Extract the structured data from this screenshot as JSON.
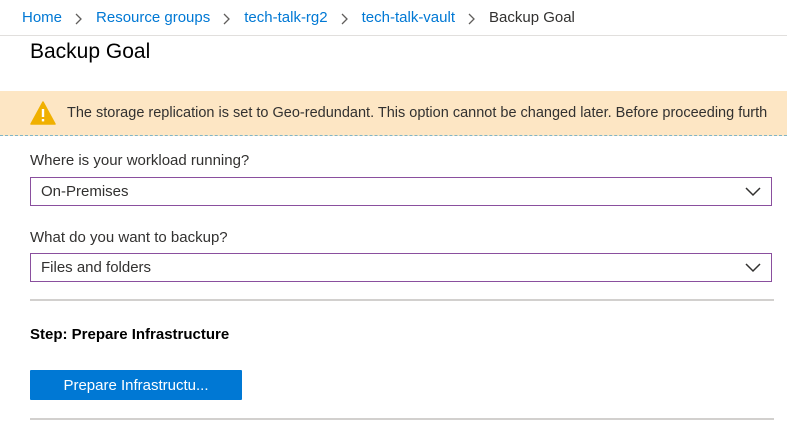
{
  "breadcrumb": {
    "items": [
      {
        "label": "Home"
      },
      {
        "label": "Resource groups"
      },
      {
        "label": "tech-talk-rg2"
      },
      {
        "label": "tech-talk-vault"
      }
    ],
    "current": "Backup Goal"
  },
  "page": {
    "title": "Backup Goal"
  },
  "warning": {
    "icon": "warning-icon",
    "text": "The storage replication is set to Geo-redundant. This option cannot be changed later. Before proceeding furth"
  },
  "form": {
    "workload": {
      "label": "Where is your workload running?",
      "value": "On-Premises"
    },
    "backup": {
      "label": "What do you want to backup?",
      "value": "Files and folders"
    }
  },
  "step": {
    "title": "Step: Prepare Infrastructure",
    "button_label": "Prepare Infrastructu..."
  },
  "colors": {
    "accent": "#0078d4",
    "warning_bg": "#fde6c4",
    "warning_icon": "#f0b000",
    "select_border": "#8a4f9e"
  }
}
